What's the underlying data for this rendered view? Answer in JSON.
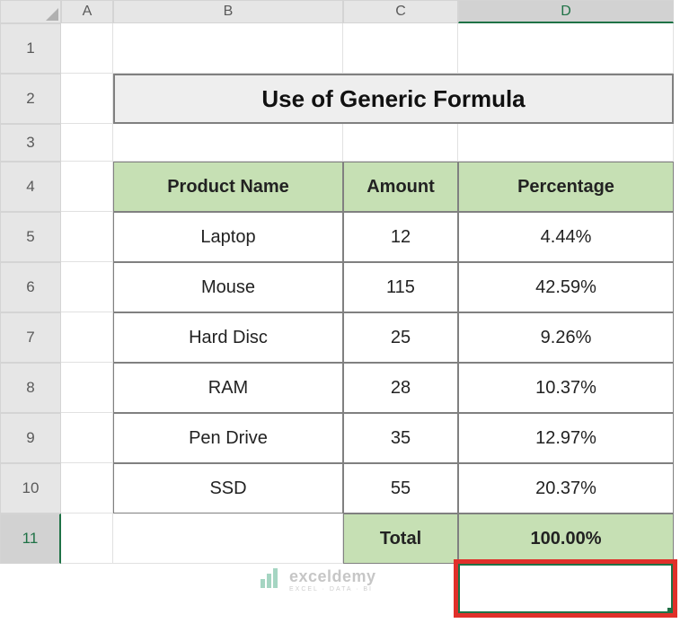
{
  "columns": [
    "A",
    "B",
    "C",
    "D"
  ],
  "row_numbers": [
    "1",
    "2",
    "3",
    "4",
    "5",
    "6",
    "7",
    "8",
    "9",
    "10",
    "11"
  ],
  "title": "Use of Generic Formula",
  "headers": {
    "product": "Product Name",
    "amount": "Amount",
    "percentage": "Percentage"
  },
  "rows": [
    {
      "product": "Laptop",
      "amount": "12",
      "percentage": "4.44%"
    },
    {
      "product": "Mouse",
      "amount": "115",
      "percentage": "42.59%"
    },
    {
      "product": "Hard Disc",
      "amount": "25",
      "percentage": "9.26%"
    },
    {
      "product": "RAM",
      "amount": "28",
      "percentage": "10.37%"
    },
    {
      "product": "Pen Drive",
      "amount": "35",
      "percentage": "12.97%"
    },
    {
      "product": "SSD",
      "amount": "55",
      "percentage": "20.37%"
    }
  ],
  "total": {
    "label": "Total",
    "value": "100.00%"
  },
  "selected_cell": "D11",
  "watermark": {
    "name": "exceldemy",
    "tagline": "EXCEL · DATA · BI"
  },
  "chart_data": {
    "type": "table",
    "title": "Use of Generic Formula",
    "columns": [
      "Product Name",
      "Amount",
      "Percentage"
    ],
    "rows": [
      [
        "Laptop",
        12,
        "4.44%"
      ],
      [
        "Mouse",
        115,
        "42.59%"
      ],
      [
        "Hard Disc",
        25,
        "9.26%"
      ],
      [
        "RAM",
        28,
        "10.37%"
      ],
      [
        "Pen Drive",
        35,
        "12.97%"
      ],
      [
        "SSD",
        55,
        "20.37%"
      ]
    ],
    "total_row": [
      "Total",
      "",
      "100.00%"
    ]
  }
}
